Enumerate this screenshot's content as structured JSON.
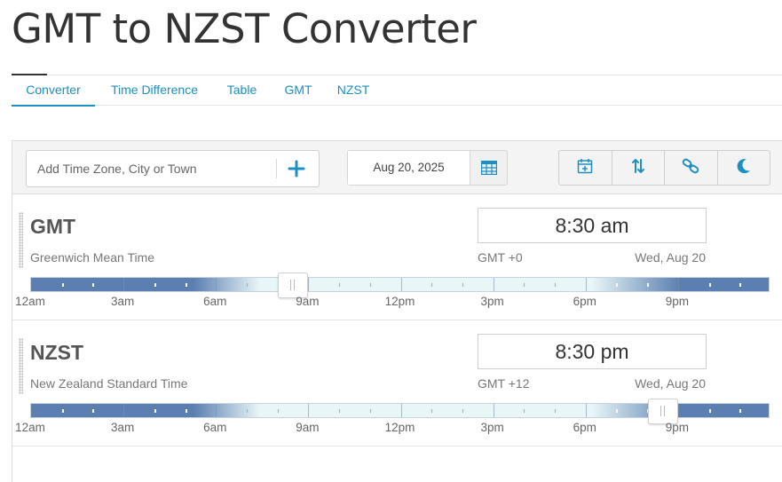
{
  "page": {
    "title": "GMT to NZST Converter"
  },
  "tabs": [
    {
      "label": "Converter",
      "active": true
    },
    {
      "label": "Time Difference",
      "active": false
    },
    {
      "label": "Table",
      "active": false
    },
    {
      "label": "GMT",
      "active": false
    },
    {
      "label": "NZST",
      "active": false
    }
  ],
  "toolbar": {
    "add_placeholder": "Add Time Zone, City or Town",
    "add_icon": "plus-icon",
    "date": "Aug 20, 2025",
    "date_icon": "calendar-grid-icon",
    "buttons": [
      {
        "name": "add-to-calendar",
        "icon": "calendar-plus-icon"
      },
      {
        "name": "reverse-order",
        "icon": "swap-vertical-icon"
      },
      {
        "name": "share-link",
        "icon": "link-icon"
      },
      {
        "name": "dark-mode",
        "icon": "moon-icon"
      }
    ]
  },
  "zones": [
    {
      "abbr": "GMT",
      "name": "Greenwich Mean Time",
      "time": "8:30 am",
      "offset": "GMT +0",
      "day": "Wed, Aug 20",
      "slider_hour": 8.5
    },
    {
      "abbr": "NZST",
      "name": "New Zealand Standard Time",
      "time": "8:30 pm",
      "offset": "GMT +12",
      "day": "Wed, Aug 20",
      "slider_hour": 20.5
    }
  ],
  "hour_labels": [
    "12am",
    "3am",
    "6am",
    "9am",
    "12pm",
    "3pm",
    "6pm",
    "9pm"
  ],
  "colors": {
    "accent": "#1c8fc3",
    "night": "#5b7fb0",
    "day": "#e8f6f8"
  }
}
